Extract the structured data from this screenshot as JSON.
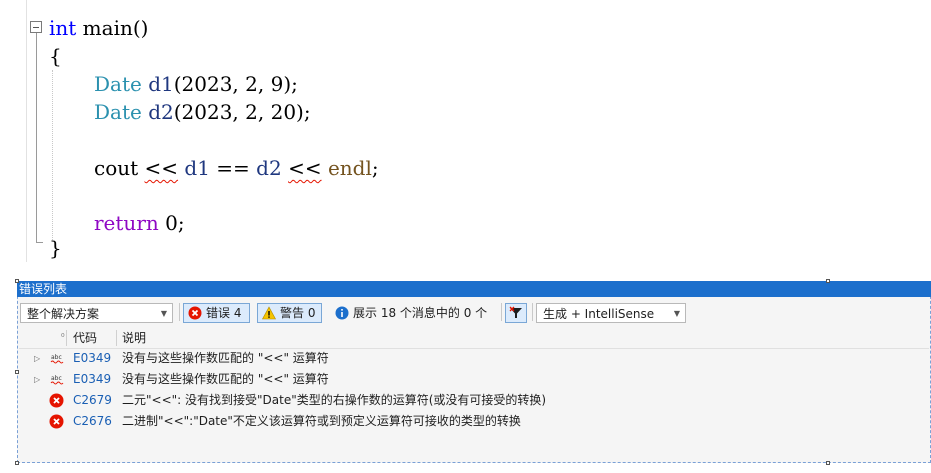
{
  "editor": {
    "line1": {
      "kw": "int",
      "rest": " main()"
    },
    "line2": "{",
    "line3": {
      "type": "Date",
      "var": "d1",
      "args": "(2023, 2, 9);"
    },
    "line4": {
      "type": "Date",
      "var": "d2",
      "args": "(2023, 2, 20);"
    },
    "line5": {
      "cout": "cout",
      "op1": "<<",
      "a": "d1",
      "eq": "==",
      "b": "d2",
      "op2": "<<",
      "endl": "endl",
      "semi": ";"
    },
    "line6": {
      "kw": "return",
      "rest": " 0;"
    },
    "line7": "}"
  },
  "error_list": {
    "title": "错误列表",
    "scope_combo": "整个解决方案",
    "errors_button": "错误 4",
    "warnings_button": "警告 0",
    "messages_button": "展示 18 个消息中的 0 个",
    "build_combo": "生成 + IntelliSense",
    "columns": {
      "code": "代码",
      "description": "说明"
    },
    "rows": [
      {
        "type": "intellisense",
        "code": "E0349",
        "description": "没有与这些操作数匹配的 \"<<\" 运算符"
      },
      {
        "type": "intellisense",
        "code": "E0349",
        "description": "没有与这些操作数匹配的 \"<<\" 运算符"
      },
      {
        "type": "error",
        "code": "C2679",
        "description": "二元\"<<\": 没有找到接受\"Date\"类型的右操作数的运算符(或没有可接受的转换)"
      },
      {
        "type": "error",
        "code": "C2676",
        "description": "二进制\"<<\":\"Date\"不定义该运算符或到预定义运算符可接收的类型的转换"
      }
    ]
  },
  "colors": {
    "keyword": "#0000ff",
    "type": "#2b91af",
    "title_bar": "#1c6fcc",
    "error_red": "#e51400"
  }
}
